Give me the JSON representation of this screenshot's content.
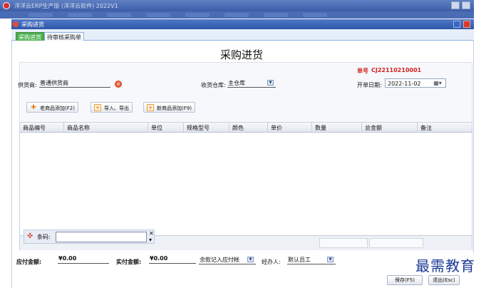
{
  "app": {
    "title": "洋洋云ERP生产版 (洋洋云软件) 2022V1"
  },
  "window": {
    "title": "采购进货"
  },
  "tabs": [
    {
      "label": "采购进货",
      "active": true
    },
    {
      "label": "待审核采购单",
      "active": false
    }
  ],
  "page": {
    "title": "采购进货"
  },
  "order": {
    "label": "单号",
    "number": "CJ22110210001",
    "color": "#d42020"
  },
  "form": {
    "supplier_label": "供货商:",
    "supplier_value": "普通供货商",
    "warehouse_label": "收货仓库:",
    "warehouse_value": "主仓库",
    "date_label": "开单日期:",
    "date_value": "2022-11-02"
  },
  "buttons": {
    "add_old": "老商品添加(F2)",
    "import_export": "导入、导出",
    "add_new": "新商品添加(F9)"
  },
  "grid": {
    "columns": [
      "商品编号",
      "商品名称",
      "单位",
      "规格型号",
      "颜色",
      "单价",
      "数量",
      "总金额",
      "备注"
    ]
  },
  "barcode": {
    "label": "条码:",
    "value": ""
  },
  "footer": {
    "payable_label": "应付金额:",
    "payable_value": "¥0.00",
    "paid_label": "实付金额:",
    "paid_value": "¥0.00",
    "balance_option": "余款记入应付帐",
    "handler_label": "经办人:",
    "handler_value": "默认员工",
    "save_label": "保存(F5)",
    "exit_label": "退出(Esc)"
  },
  "watermark": "最需教育"
}
